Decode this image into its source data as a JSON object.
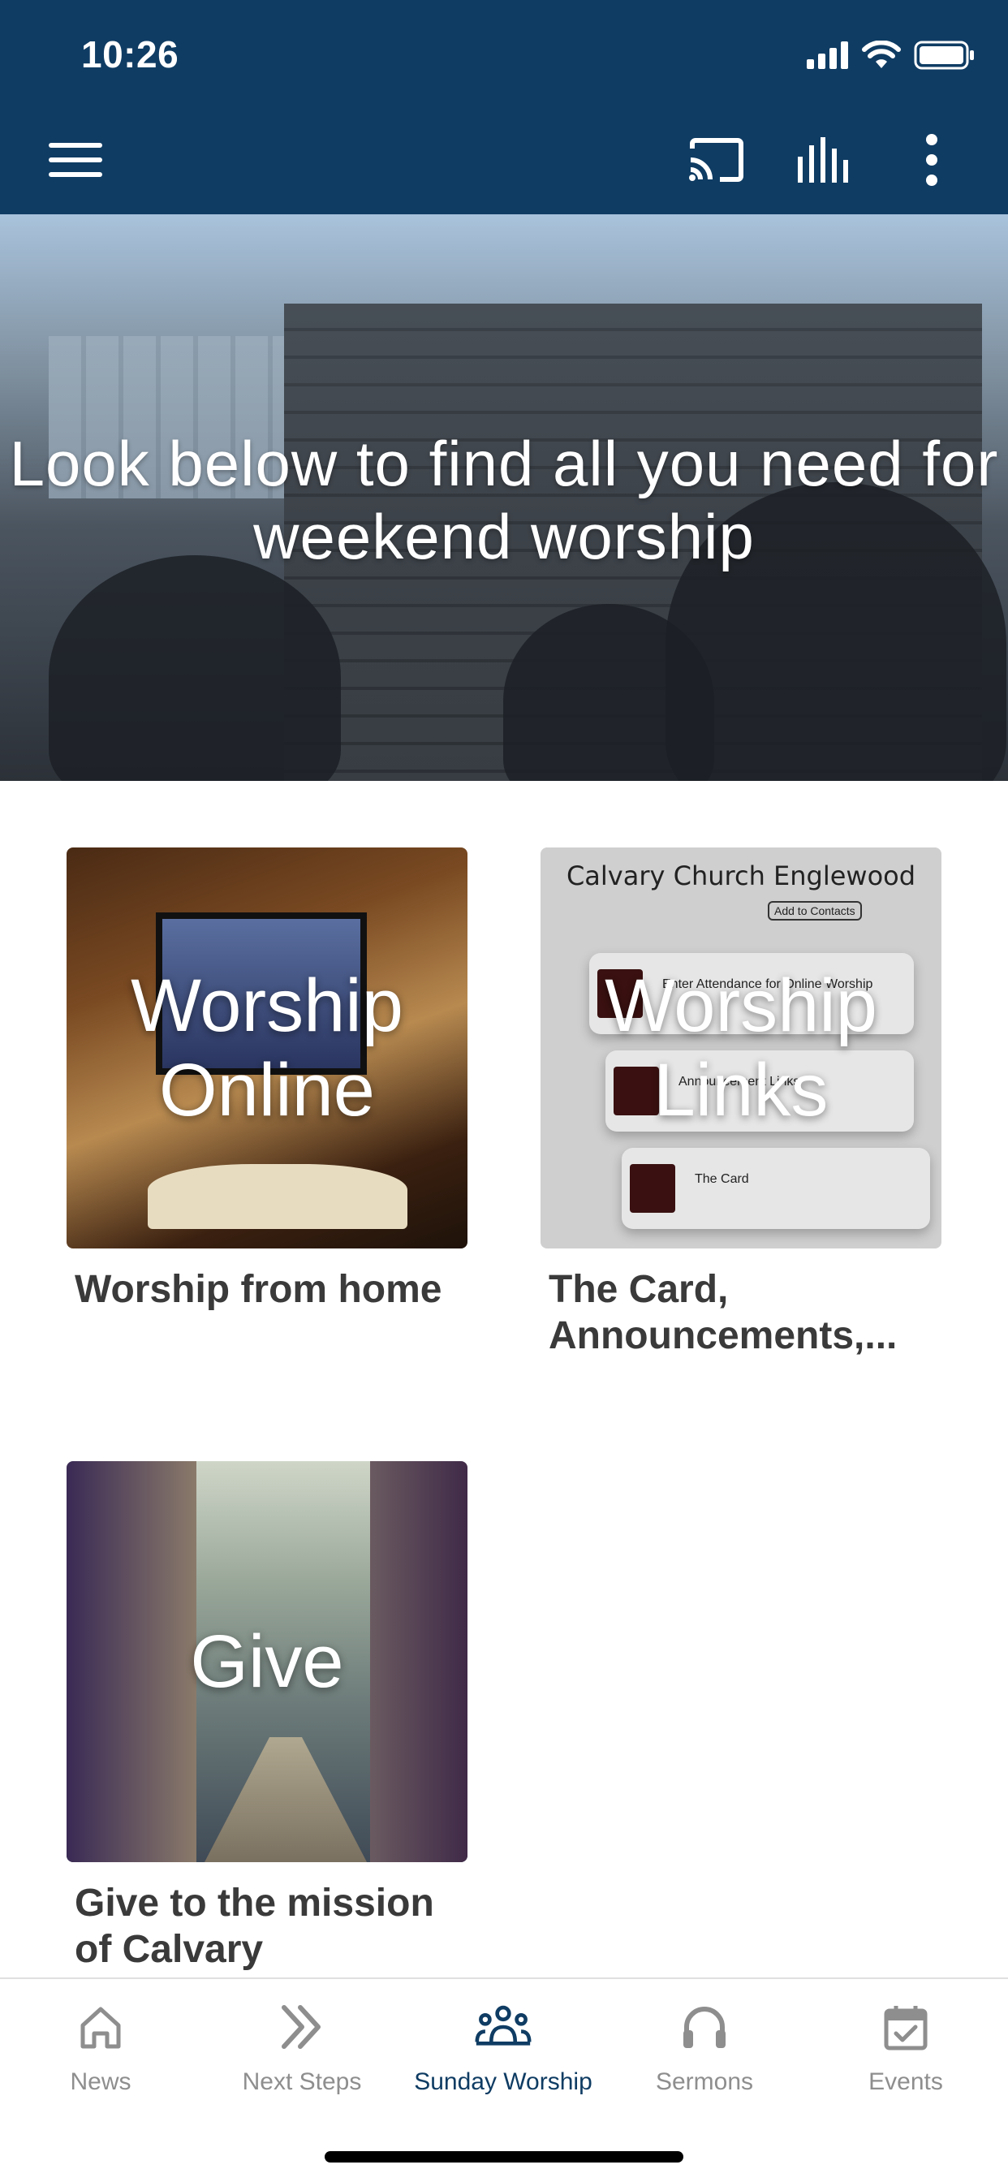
{
  "status_bar": {
    "time": "10:26"
  },
  "toolbar": {
    "icons": [
      "menu-icon",
      "cast-icon",
      "audio-bars-icon",
      "more-vert-icon"
    ]
  },
  "hero": {
    "text": "Look below to find all you need for weekend worship"
  },
  "cards": [
    {
      "image_label": "Worship\nOnline",
      "caption": "Worship from home"
    },
    {
      "image_label": "Worship\nLinks",
      "caption": "The Card, Announcements,...",
      "image_detail": {
        "title": "Calvary Church Englewood",
        "button": "Add to Contacts",
        "items": [
          "Enter Attendance for Online Worship",
          "Announcement Links",
          "The Card"
        ]
      }
    },
    {
      "image_label": "Give",
      "caption": "Give to the mission of Calvary"
    }
  ],
  "tabs": [
    {
      "label": "News",
      "icon": "home-icon",
      "active": false
    },
    {
      "label": "Next Steps",
      "icon": "double-chevron-right-icon",
      "active": false
    },
    {
      "label": "Sunday Worship",
      "icon": "people-group-icon",
      "active": true
    },
    {
      "label": "Sermons",
      "icon": "headphones-icon",
      "active": false
    },
    {
      "label": "Events",
      "icon": "calendar-check-icon",
      "active": false
    }
  ],
  "colors": {
    "header": "#0f3c63",
    "tab_active": "#0f3c63",
    "tab_inactive": "#8e8e8e"
  }
}
